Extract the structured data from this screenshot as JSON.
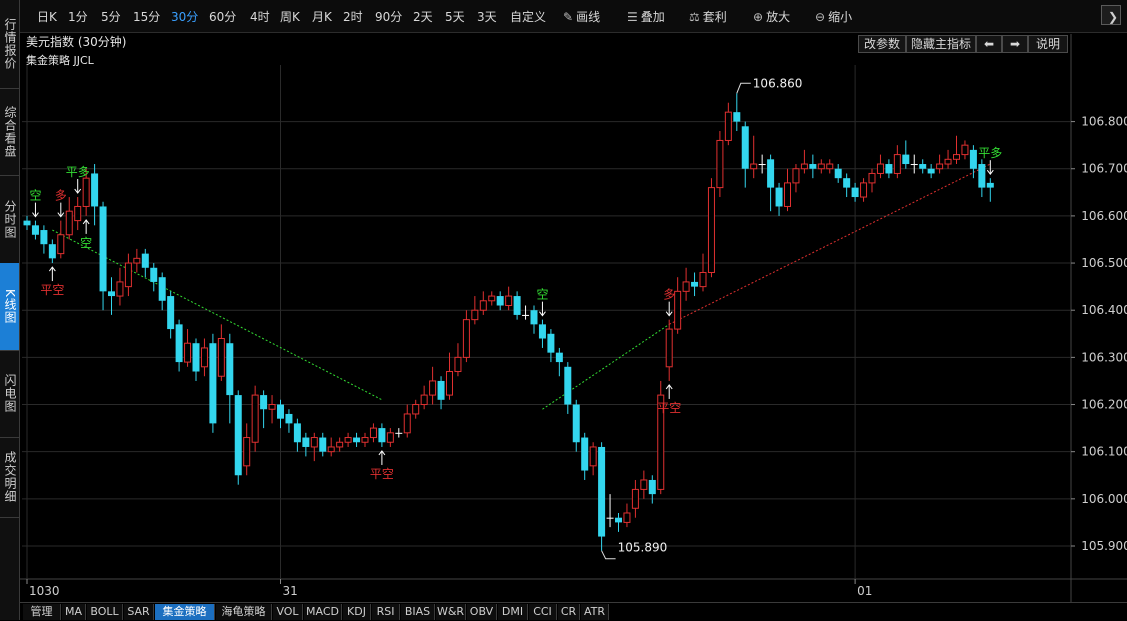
{
  "left_tabs": [
    {
      "label": "行情报价",
      "active": false
    },
    {
      "label": "综合看盘",
      "active": false
    },
    {
      "label": "分时图",
      "active": false
    },
    {
      "label": "K线图",
      "active": true
    },
    {
      "label": "闪电图",
      "active": false
    },
    {
      "label": "成交明细",
      "active": false
    }
  ],
  "toolbar": {
    "periods": [
      "日K",
      "1分",
      "5分",
      "15分",
      "30分",
      "60分",
      "4时",
      "周K",
      "月K",
      "2时",
      "90分",
      "2天",
      "5天",
      "3天",
      "自定义"
    ],
    "active_period": "30分",
    "tools": [
      {
        "label": "画线",
        "icon": "pencil-icon"
      },
      {
        "label": "叠加",
        "icon": "layers-icon"
      },
      {
        "label": "套利",
        "icon": "arbitrage-icon"
      },
      {
        "label": "放大",
        "icon": "zoom-in-icon"
      },
      {
        "label": "缩小",
        "icon": "zoom-out-icon"
      }
    ]
  },
  "chart": {
    "title": "美元指数 (30分钟)",
    "indicator_label": "集金策略 JJCL",
    "buttons": {
      "params": "改参数",
      "hide": "隐藏主指标",
      "prev": "⬅",
      "next": "➡",
      "help": "说明"
    }
  },
  "chart_data": {
    "type": "candlestick",
    "ylim": [
      105.83,
      106.92
    ],
    "yticks": [
      105.9,
      106.0,
      106.1,
      106.2,
      106.3,
      106.4,
      106.5,
      106.6,
      106.7,
      106.8
    ],
    "ytick_labels": [
      "105.900",
      "106.000",
      "106.100",
      "106.200",
      "106.300",
      "106.400",
      "106.500",
      "106.600",
      "106.700",
      "106.800"
    ],
    "date_labels": [
      {
        "index": 0,
        "label": "1030"
      },
      {
        "index": 30,
        "label": "31"
      },
      {
        "index": 98,
        "label": "01"
      }
    ],
    "high_label": "106.860",
    "low_label": "105.890",
    "candles": [
      [
        106.59,
        106.58,
        106.6,
        106.57
      ],
      [
        106.58,
        106.56,
        106.59,
        106.55
      ],
      [
        106.57,
        106.54,
        106.58,
        106.52
      ],
      [
        106.54,
        106.51,
        106.55,
        106.5
      ],
      [
        106.52,
        106.56,
        106.59,
        106.51
      ],
      [
        106.56,
        106.61,
        106.64,
        106.55
      ],
      [
        106.59,
        106.62,
        106.64,
        106.57
      ],
      [
        106.62,
        106.68,
        106.7,
        106.6
      ],
      [
        106.69,
        106.62,
        106.71,
        106.58
      ],
      [
        106.62,
        106.44,
        106.63,
        106.4
      ],
      [
        106.44,
        106.43,
        106.47,
        106.39
      ],
      [
        106.43,
        106.46,
        106.49,
        106.41
      ],
      [
        106.45,
        106.5,
        106.52,
        106.43
      ],
      [
        106.5,
        106.51,
        106.53,
        106.48
      ],
      [
        106.52,
        106.49,
        106.53,
        106.47
      ],
      [
        106.49,
        106.46,
        106.5,
        106.44
      ],
      [
        106.47,
        106.42,
        106.48,
        106.4
      ],
      [
        106.43,
        106.36,
        106.44,
        106.34
      ],
      [
        106.37,
        106.29,
        106.38,
        106.27
      ],
      [
        106.29,
        106.33,
        106.36,
        106.28
      ],
      [
        106.33,
        106.27,
        106.34,
        106.25
      ],
      [
        106.28,
        106.32,
        106.34,
        106.26
      ],
      [
        106.33,
        106.16,
        106.35,
        106.14
      ],
      [
        106.26,
        106.34,
        106.37,
        106.25
      ],
      [
        106.33,
        106.22,
        106.35,
        106.16
      ],
      [
        106.22,
        106.05,
        106.23,
        106.03
      ],
      [
        106.07,
        106.13,
        106.16,
        106.05
      ],
      [
        106.12,
        106.22,
        106.24,
        106.1
      ],
      [
        106.22,
        106.19,
        106.23,
        106.15
      ],
      [
        106.19,
        106.2,
        106.22,
        106.16
      ],
      [
        106.2,
        106.17,
        106.21,
        106.15
      ],
      [
        106.18,
        106.16,
        106.19,
        106.14
      ],
      [
        106.16,
        106.12,
        106.17,
        106.1
      ],
      [
        106.13,
        106.11,
        106.14,
        106.09
      ],
      [
        106.11,
        106.13,
        106.14,
        106.08
      ],
      [
        106.13,
        106.1,
        106.14,
        106.09
      ],
      [
        106.1,
        106.11,
        106.13,
        106.09
      ],
      [
        106.11,
        106.12,
        106.13,
        106.1
      ],
      [
        106.12,
        106.13,
        106.14,
        106.11
      ],
      [
        106.13,
        106.12,
        106.14,
        106.11
      ],
      [
        106.12,
        106.13,
        106.14,
        106.11
      ],
      [
        106.13,
        106.15,
        106.16,
        106.12
      ],
      [
        106.15,
        106.12,
        106.16,
        106.11
      ],
      [
        106.12,
        106.14,
        106.15,
        106.11
      ],
      [
        106.14,
        106.14,
        106.15,
        106.13
      ],
      [
        106.14,
        106.18,
        106.2,
        106.13
      ],
      [
        106.18,
        106.2,
        106.21,
        106.17
      ],
      [
        106.2,
        106.22,
        106.24,
        106.19
      ],
      [
        106.22,
        106.25,
        106.28,
        106.2
      ],
      [
        106.25,
        106.21,
        106.26,
        106.19
      ],
      [
        106.22,
        106.27,
        106.31,
        106.21
      ],
      [
        106.27,
        106.3,
        106.33,
        106.26
      ],
      [
        106.3,
        106.38,
        106.4,
        106.29
      ],
      [
        106.38,
        106.4,
        106.43,
        106.37
      ],
      [
        106.4,
        106.42,
        106.44,
        106.39
      ],
      [
        106.42,
        106.43,
        106.44,
        106.41
      ],
      [
        106.43,
        106.41,
        106.44,
        106.4
      ],
      [
        106.41,
        106.43,
        106.45,
        106.4
      ],
      [
        106.43,
        106.39,
        106.44,
        106.38
      ],
      [
        106.39,
        106.39,
        106.41,
        106.38
      ],
      [
        106.4,
        106.37,
        106.41,
        106.35
      ],
      [
        106.37,
        106.34,
        106.38,
        106.32
      ],
      [
        106.35,
        106.31,
        106.36,
        106.29
      ],
      [
        106.31,
        106.29,
        106.32,
        106.26
      ],
      [
        106.28,
        106.2,
        106.29,
        106.18
      ],
      [
        106.2,
        106.12,
        106.21,
        106.1
      ],
      [
        106.13,
        106.06,
        106.14,
        106.04
      ],
      [
        106.07,
        106.11,
        106.12,
        106.05
      ],
      [
        106.11,
        105.92,
        106.12,
        105.89
      ],
      [
        105.96,
        105.96,
        106.01,
        105.94
      ],
      [
        105.96,
        105.95,
        105.97,
        105.93
      ],
      [
        105.95,
        105.97,
        105.99,
        105.94
      ],
      [
        105.98,
        106.02,
        106.04,
        105.96
      ],
      [
        106.02,
        106.04,
        106.06,
        106.0
      ],
      [
        106.04,
        106.01,
        106.05,
        105.99
      ],
      [
        106.02,
        106.22,
        106.25,
        106.01
      ],
      [
        106.28,
        106.36,
        106.38,
        106.25
      ],
      [
        106.36,
        106.44,
        106.47,
        106.35
      ],
      [
        106.44,
        106.46,
        106.49,
        106.42
      ],
      [
        106.46,
        106.45,
        106.48,
        106.43
      ],
      [
        106.45,
        106.48,
        106.52,
        106.44
      ],
      [
        106.48,
        106.66,
        106.68,
        106.47
      ],
      [
        106.66,
        106.76,
        106.78,
        106.64
      ],
      [
        106.76,
        106.82,
        106.84,
        106.75
      ],
      [
        106.82,
        106.8,
        106.86,
        106.78
      ],
      [
        106.79,
        106.7,
        106.8,
        106.66
      ],
      [
        106.7,
        106.71,
        106.77,
        106.68
      ],
      [
        106.71,
        106.71,
        106.73,
        106.69
      ],
      [
        106.72,
        106.66,
        106.73,
        106.61
      ],
      [
        106.66,
        106.62,
        106.67,
        106.6
      ],
      [
        106.62,
        106.67,
        106.7,
        106.61
      ],
      [
        106.67,
        106.7,
        106.71,
        106.65
      ],
      [
        106.7,
        106.71,
        106.74,
        106.69
      ],
      [
        106.71,
        106.7,
        106.73,
        106.68
      ],
      [
        106.7,
        106.71,
        106.72,
        106.69
      ],
      [
        106.7,
        106.71,
        106.72,
        106.69
      ],
      [
        106.7,
        106.68,
        106.71,
        106.67
      ],
      [
        106.68,
        106.66,
        106.69,
        106.64
      ],
      [
        106.66,
        106.64,
        106.67,
        106.63
      ],
      [
        106.64,
        106.67,
        106.68,
        106.63
      ],
      [
        106.67,
        106.69,
        106.7,
        106.65
      ],
      [
        106.69,
        106.71,
        106.73,
        106.68
      ],
      [
        106.71,
        106.69,
        106.72,
        106.68
      ],
      [
        106.69,
        106.73,
        106.75,
        106.68
      ],
      [
        106.73,
        106.71,
        106.76,
        106.7
      ],
      [
        106.71,
        106.71,
        106.73,
        106.69
      ],
      [
        106.71,
        106.7,
        106.72,
        106.69
      ],
      [
        106.7,
        106.69,
        106.71,
        106.68
      ],
      [
        106.7,
        106.71,
        106.73,
        106.69
      ],
      [
        106.71,
        106.72,
        106.74,
        106.7
      ],
      [
        106.72,
        106.73,
        106.77,
        106.71
      ],
      [
        106.73,
        106.75,
        106.76,
        106.72
      ],
      [
        106.74,
        106.7,
        106.75,
        106.68
      ],
      [
        106.71,
        106.66,
        106.72,
        106.64
      ],
      [
        106.67,
        106.66,
        106.68,
        106.63
      ]
    ],
    "signals": [
      {
        "index": 1,
        "label": "空",
        "type": "short"
      },
      {
        "index": 3,
        "label": "平空",
        "type": "close-short"
      },
      {
        "index": 4,
        "label": "多",
        "type": "long"
      },
      {
        "index": 6,
        "label": "平多",
        "type": "close-long"
      },
      {
        "index": 7,
        "label": "空",
        "type": "short-below"
      },
      {
        "index": 42,
        "label": "平空",
        "type": "close-short"
      },
      {
        "index": 61,
        "label": "空",
        "type": "short"
      },
      {
        "index": 76,
        "label": "平空",
        "type": "close-short"
      },
      {
        "index": 76,
        "label": "多",
        "type": "long"
      },
      {
        "index": 114,
        "label": "平多",
        "type": "close-long"
      }
    ],
    "trend_lines": [
      {
        "from": [
          3,
          106.57
        ],
        "to": [
          42,
          106.21
        ],
        "color": "#33dd33"
      },
      {
        "from": [
          61,
          106.19
        ],
        "to": [
          76,
          106.37
        ],
        "color": "#33dd33"
      },
      {
        "from": [
          76,
          106.37
        ],
        "to": [
          114,
          106.71
        ],
        "color": "#e03030"
      }
    ]
  },
  "bottom_tabs": [
    {
      "label": "管理",
      "active": false
    },
    {
      "label": "MA",
      "active": false
    },
    {
      "label": "BOLL",
      "active": false
    },
    {
      "label": "SAR",
      "active": false
    },
    {
      "label": "集金策略",
      "active": true
    },
    {
      "label": "海龟策略",
      "active": false
    },
    {
      "label": "VOL",
      "active": false
    },
    {
      "label": "MACD",
      "active": false
    },
    {
      "label": "KDJ",
      "active": false
    },
    {
      "label": "RSI",
      "active": false
    },
    {
      "label": "BIAS",
      "active": false
    },
    {
      "label": "W&R",
      "active": false
    },
    {
      "label": "OBV",
      "active": false
    },
    {
      "label": "DMI",
      "active": false
    },
    {
      "label": "CCI",
      "active": false
    },
    {
      "label": "CR",
      "active": false
    },
    {
      "label": "ATR",
      "active": false
    }
  ],
  "colors": {
    "up": "#e03030",
    "down": "#33d6ee",
    "grid": "#2a2a2a",
    "axis": "#444444",
    "signal_green": "#33dd33",
    "signal_red": "#e03030"
  }
}
